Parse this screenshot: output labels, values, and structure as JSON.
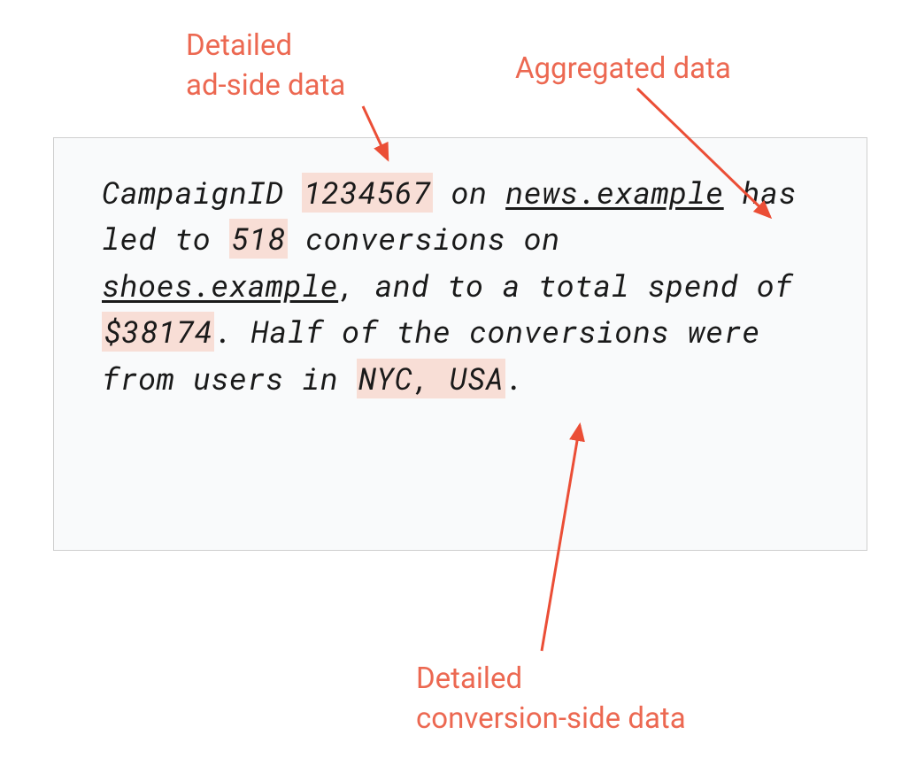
{
  "annotations": {
    "top_left_line1": "Detailed",
    "top_left_line2": "ad-side data",
    "top_right": "Aggregated data",
    "bottom_line1": "Detailed",
    "bottom_line2": "conversion-side data"
  },
  "content": {
    "part1": "CampaignID ",
    "campaign_id": "1234567",
    "part2": " on ",
    "site1": "news.example",
    "part3": " has led to ",
    "conversions": "518",
    "part4": " conversions on ",
    "site2": "shoes.example",
    "part5": ", and to a total spend of ",
    "spend": "$38174",
    "part6": ". Half of the conversions were from users in ",
    "location": "NYC, USA",
    "part7": "."
  },
  "colors": {
    "annotation": "#ec6851",
    "highlight": "#f8ded6",
    "box_bg": "#f9fafb",
    "box_border": "#cfcfcf",
    "text": "#1a1a1a"
  }
}
